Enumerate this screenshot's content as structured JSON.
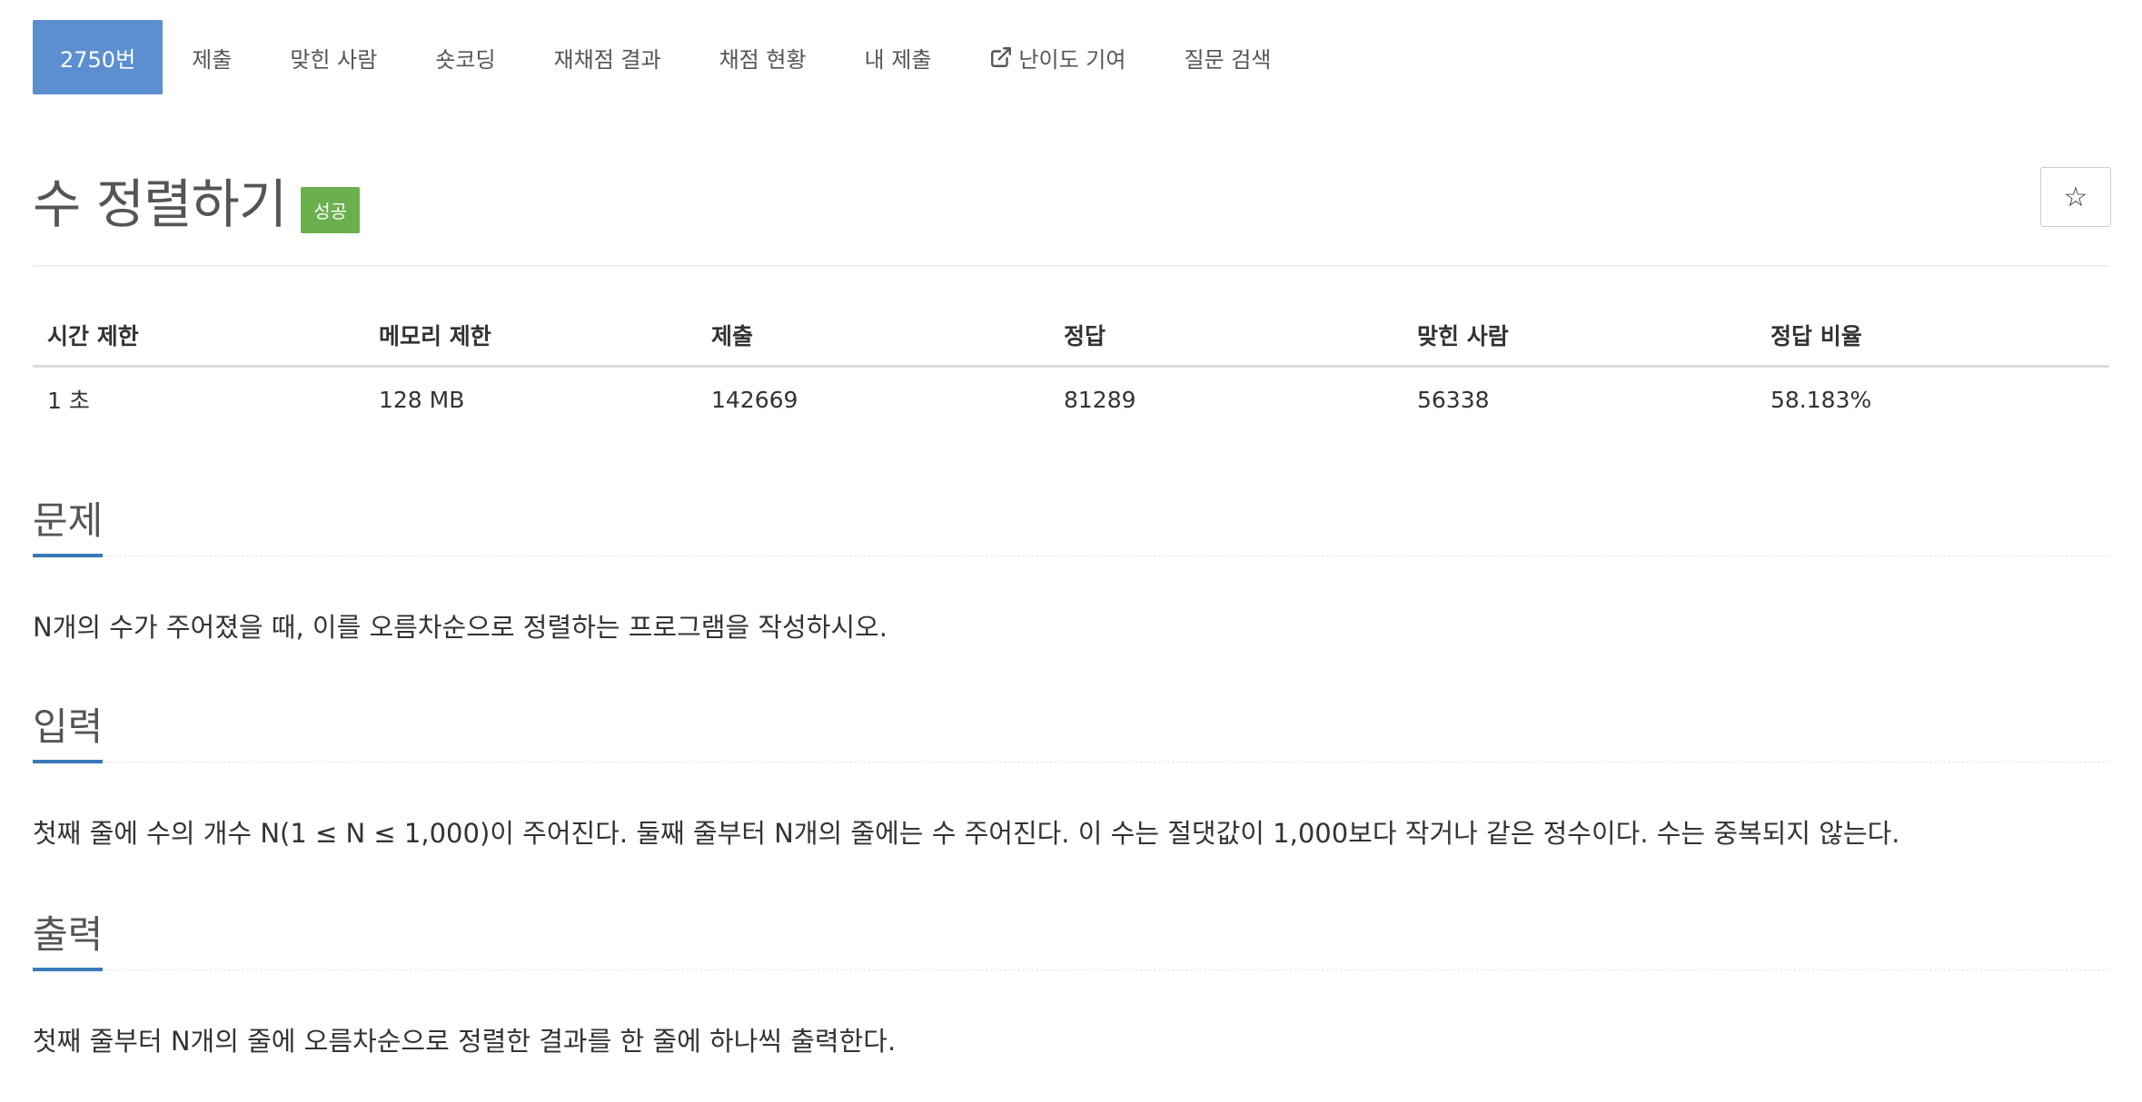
{
  "nav": {
    "tabs": [
      {
        "label": "2750번",
        "active": true
      },
      {
        "label": "제출"
      },
      {
        "label": "맞힌 사람"
      },
      {
        "label": "숏코딩"
      },
      {
        "label": "재채점 결과"
      },
      {
        "label": "채점 현황"
      },
      {
        "label": "내 제출"
      },
      {
        "label": "난이도 기여",
        "icon": "external-link-icon"
      },
      {
        "label": "질문 검색"
      }
    ]
  },
  "problem": {
    "title": "수 정렬하기",
    "status_badge": "성공",
    "star_icon": "☆"
  },
  "info_table": {
    "headers": [
      "시간 제한",
      "메모리 제한",
      "제출",
      "정답",
      "맞힌 사람",
      "정답 비율"
    ],
    "values": [
      "1 초",
      "128 MB",
      "142669",
      "81289",
      "56338",
      "58.183%"
    ]
  },
  "sections": {
    "problem": {
      "title": "문제",
      "text": "N개의 수가 주어졌을 때, 이를 오름차순으로 정렬하는 프로그램을 작성하시오."
    },
    "input": {
      "title": "입력",
      "text": "첫째 줄에 수의 개수 N(1 ≤ N ≤ 1,000)이 주어진다. 둘째 줄부터 N개의 줄에는 수 주어진다. 이 수는 절댓값이 1,000보다 작거나 같은 정수이다. 수는 중복되지 않는다."
    },
    "output": {
      "title": "출력",
      "text": "첫째 줄부터 N개의 줄에 오름차순으로 정렬한 결과를 한 줄에 하나씩 출력한다."
    }
  },
  "colors": {
    "active_tab": "#5b8fd0",
    "badge_success": "#6ab04c",
    "section_underline": "#3a79b8"
  }
}
